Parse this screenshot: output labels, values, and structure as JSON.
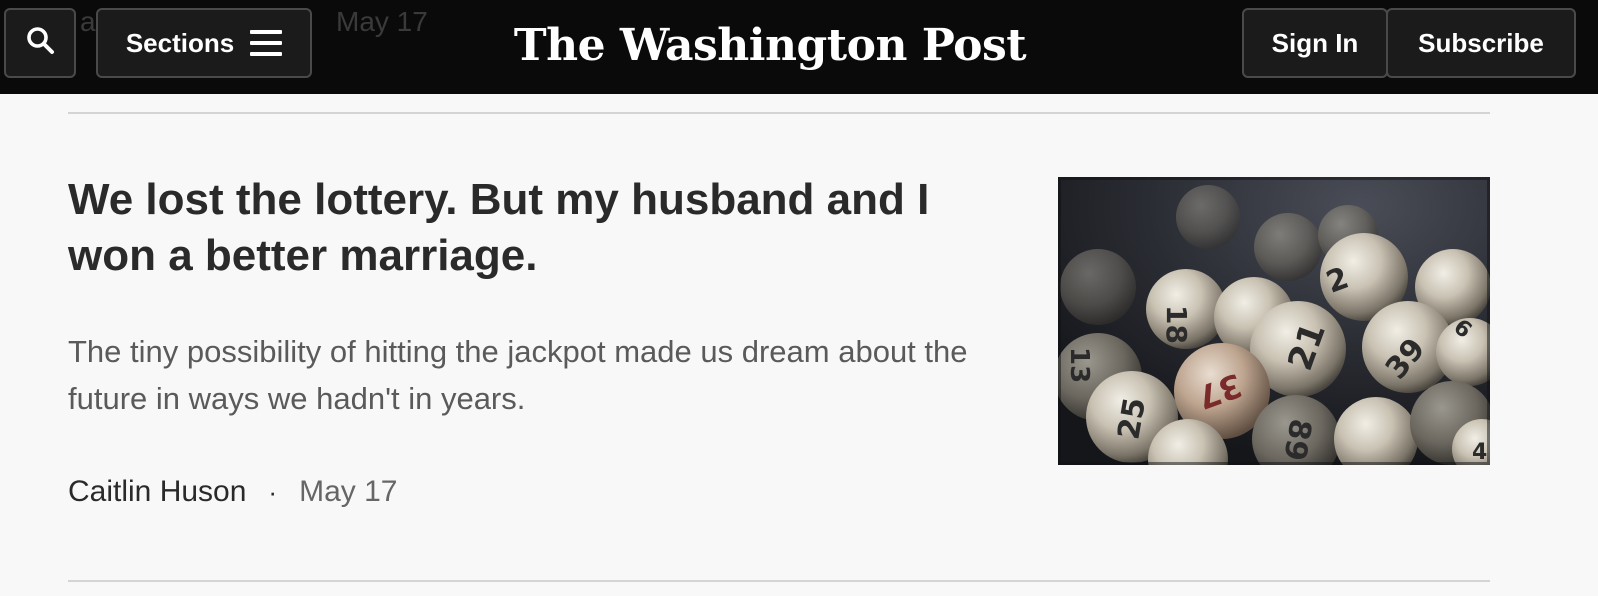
{
  "header": {
    "behind_letter": "a",
    "behind_date": "May 17",
    "sections_label": "Sections",
    "logo_text": "The Washington Post",
    "signin_label": "Sign In",
    "subscribe_label": "Subscribe",
    "colors": {
      "bar": "#0a0a0a",
      "button_bg": "#1b1b1b",
      "button_border": "#4a4a4a",
      "text": "#ffffff"
    }
  },
  "article": {
    "headline": "We lost the lottery. But my husband and I won a better marriage.",
    "dek": "The tiny possibility of hitting the jackpot made us dream about the future in ways we hadn't in years.",
    "author": "Caitlin Huson",
    "separator": "·",
    "date": "May 17",
    "image": {
      "subject": "lottery-balls",
      "ball_numbers": [
        "18",
        "2",
        "21",
        "37",
        "25",
        "89",
        "39",
        "13",
        "6",
        "4"
      ]
    }
  }
}
